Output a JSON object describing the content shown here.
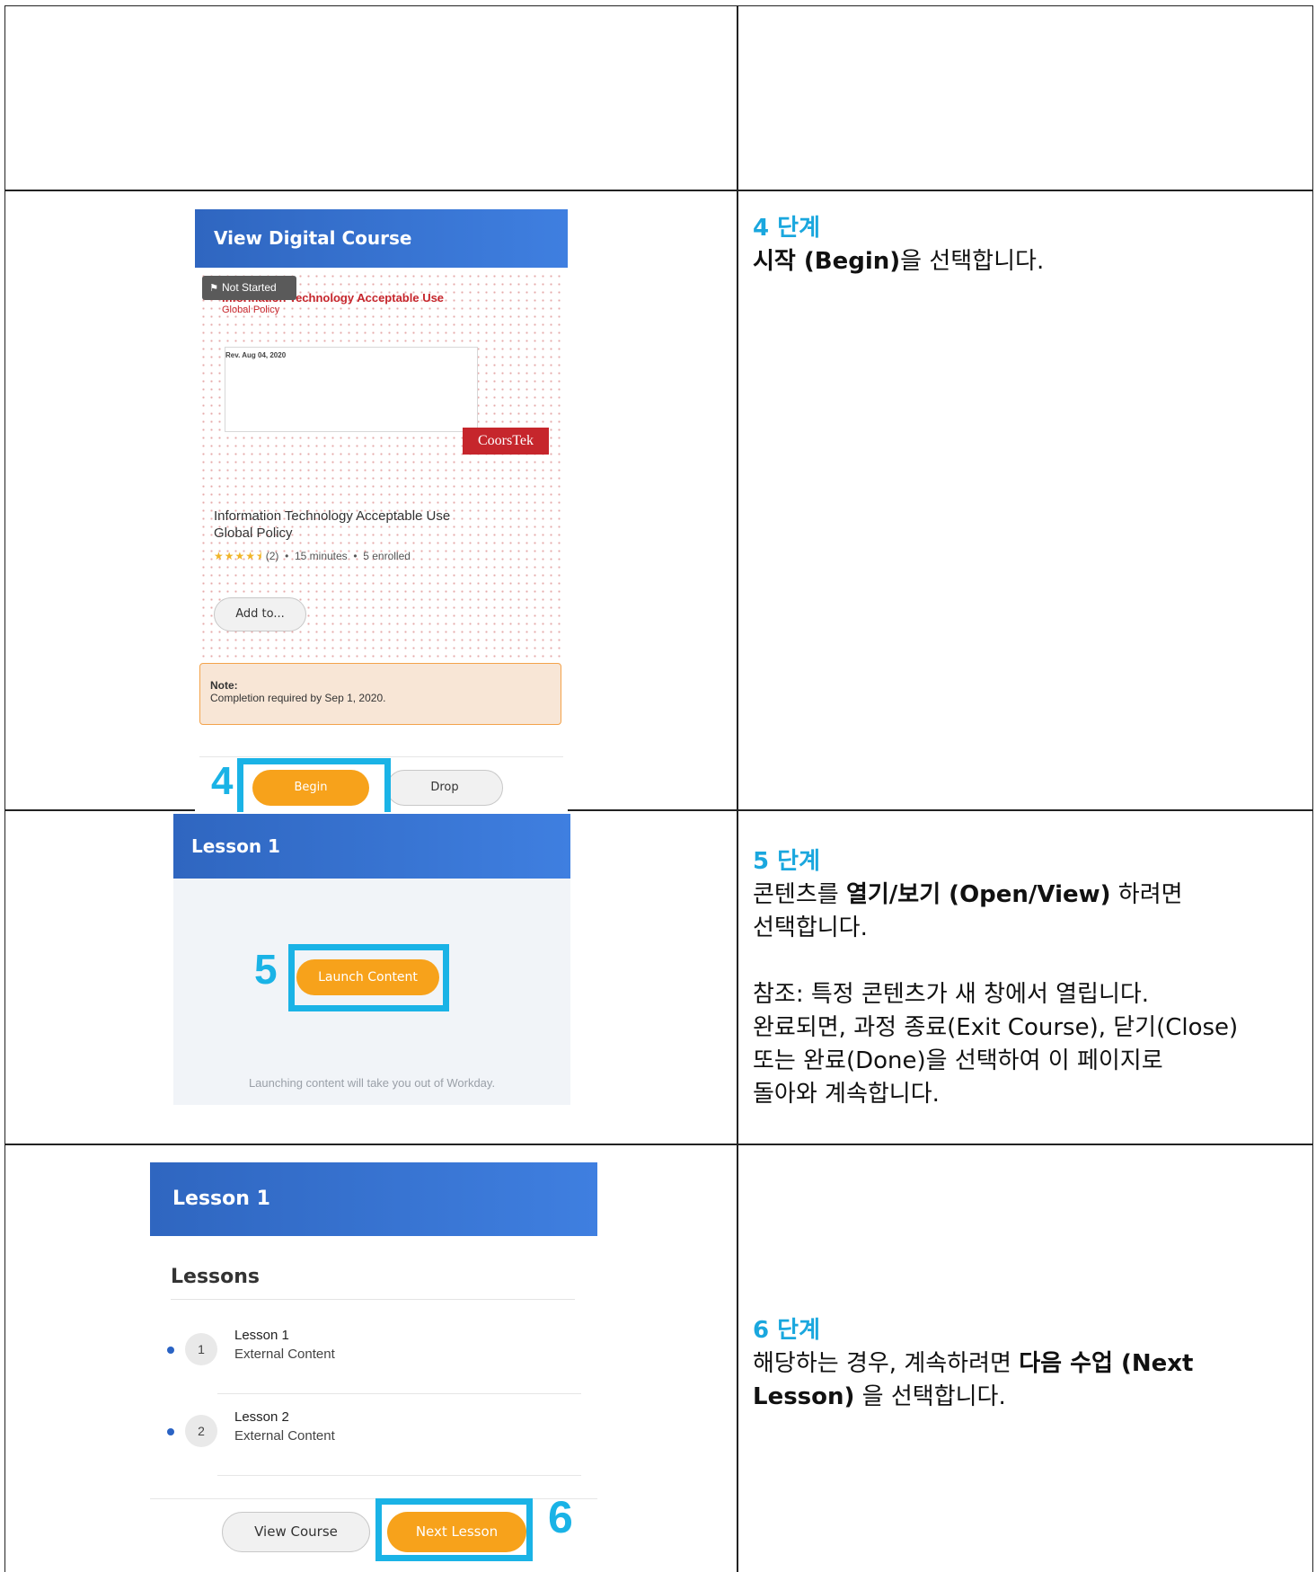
{
  "steps": [
    {
      "number": "4",
      "unit": "단계",
      "line1_bold": "시작 (Begin)",
      "line1_rest": "을 선택합니다."
    },
    {
      "number": "5",
      "unit": "단계",
      "line1_pre": "콘텐츠를 ",
      "line1_bold": "열기/보기 (Open/View)",
      "line1_post": " 하려면",
      "line2": "선택합니다.",
      "note1": "참조: 특정 콘텐츠가 새 창에서 열립니다.",
      "note2": "완료되면, 과정 종료(Exit Course), 닫기(Close)",
      "note3": "또는 완료(Done)을 선택하여 이 페이지로",
      "note4": "돌아와 계속합니다."
    },
    {
      "number": "6",
      "unit": "단계",
      "line1_pre": "해당하는 경우, 계속하려면 ",
      "line1_bold": "다음 수업 (Next",
      "line2_bold": "Lesson)",
      "line2_rest": " 을 선택합니다."
    }
  ],
  "shot1": {
    "header": "View Digital Course",
    "badge": "Not Started",
    "thumb_title": "Information Technology Acceptable Use",
    "thumb_subtitle": "Global Policy",
    "thumb_rev": "Rev. Aug 04, 2020",
    "logo": "CoorsTek",
    "course_title_line1": "Information Technology Acceptable Use",
    "course_title_line2": "Global Policy",
    "stars": "★★★★⯨",
    "rating_count": "(2)",
    "duration": "15 minutes",
    "enrolled": "5 enrolled",
    "add_button": "Add to...",
    "note_label": "Note:",
    "note_text": "Completion required by Sep 1, 2020.",
    "begin_button": "Begin",
    "drop_button": "Drop",
    "callout": "4"
  },
  "shot2": {
    "header": "Lesson 1",
    "launch_button": "Launch Content",
    "launch_note": "Launching content will take you out of Workday.",
    "callout": "5"
  },
  "shot3": {
    "header": "Lesson 1",
    "section_title": "Lessons",
    "lessons": [
      {
        "index": "1",
        "title": "Lesson 1",
        "type": "External Content"
      },
      {
        "index": "2",
        "title": "Lesson 2",
        "type": "External Content"
      }
    ],
    "view_course_button": "View Course",
    "next_lesson_button": "Next Lesson",
    "callout": "6"
  },
  "colors": {
    "callout": "#1ab3e6",
    "header_blue": "#3373d6",
    "orange_button": "#f7a21b",
    "coorstek_red": "#c6262c"
  }
}
